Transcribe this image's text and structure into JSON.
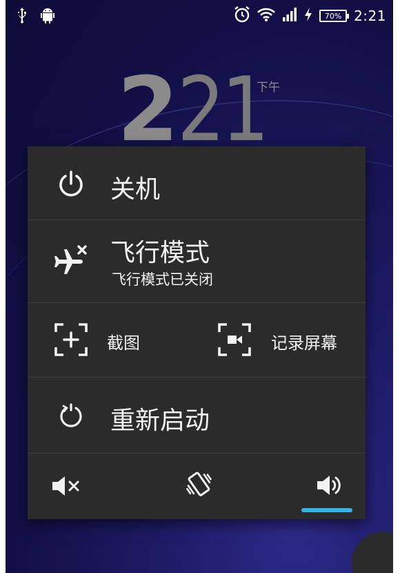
{
  "status_bar": {
    "left_icons": [
      "usb-icon",
      "android-icon"
    ],
    "right_icons": [
      "alarm-icon",
      "wifi-icon",
      "signal-icon",
      "charging-icon"
    ],
    "battery_level": "70%",
    "time": "2:21"
  },
  "lock_clock": {
    "hour": "2",
    "minute": "21",
    "ampm": "下午"
  },
  "power_menu": {
    "shutdown": {
      "label": "关机",
      "icon": "power-icon"
    },
    "airplane": {
      "label": "飞行模式",
      "status": "飞行模式已关闭",
      "icon": "airplane-icon"
    },
    "screenshot": {
      "label": "截图",
      "icon": "screenshot-icon"
    },
    "record": {
      "label": "记录屏幕",
      "icon": "screen-record-icon"
    },
    "reboot": {
      "label": "重新启动",
      "icon": "restart-icon"
    },
    "sound_modes": {
      "options": [
        "mute-icon",
        "vibrate-icon",
        "sound-on-icon"
      ],
      "selected": "sound-on-icon",
      "accent_color": "#33b5e5"
    }
  }
}
